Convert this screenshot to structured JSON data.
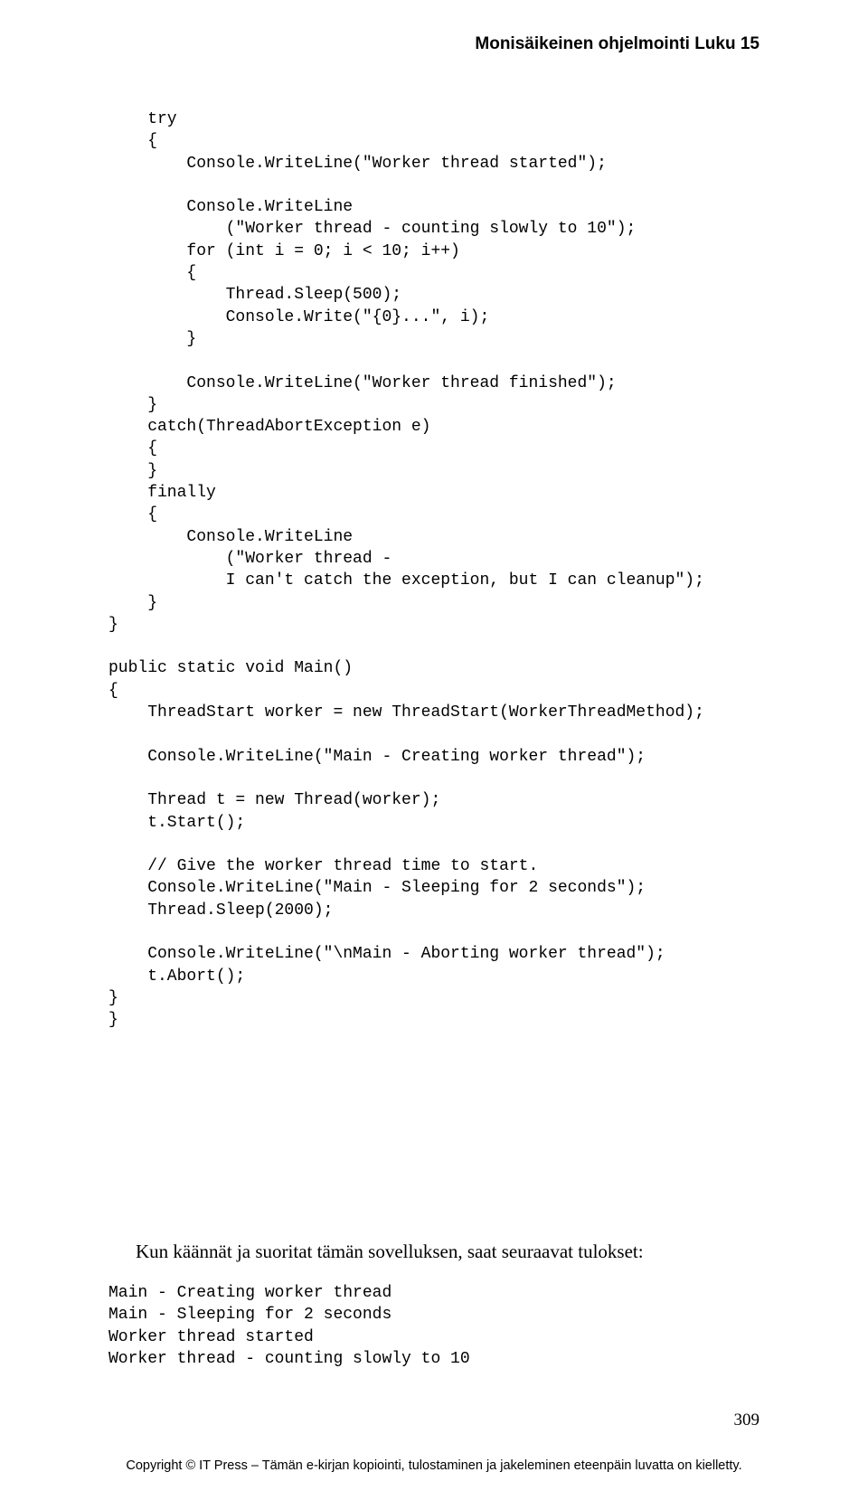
{
  "header": "Monisäikeinen ohjelmointi  Luku 15",
  "code": "    try\n    {\n        Console.WriteLine(\"Worker thread started\");\n\n        Console.WriteLine\n            (\"Worker thread - counting slowly to 10\");\n        for (int i = 0; i < 10; i++)\n        {\n            Thread.Sleep(500);\n            Console.Write(\"{0}...\", i);\n        }\n\n        Console.WriteLine(\"Worker thread finished\");\n    }\n    catch(ThreadAbortException e)\n    {\n    }\n    finally\n    {\n        Console.WriteLine\n            (\"Worker thread -\n            I can't catch the exception, but I can cleanup\");\n    }\n}\n\npublic static void Main()\n{\n    ThreadStart worker = new ThreadStart(WorkerThreadMethod);\n\n    Console.WriteLine(\"Main - Creating worker thread\");\n\n    Thread t = new Thread(worker);\n    t.Start();\n\n    // Give the worker thread time to start.\n    Console.WriteLine(\"Main - Sleeping for 2 seconds\");\n    Thread.Sleep(2000);\n\n    Console.WriteLine(\"\\nMain - Aborting worker thread\");\n    t.Abort();\n}\n}",
  "body_text": "Kun käännät ja suoritat tämän sovelluksen, saat seuraavat tulokset:",
  "output": "Main - Creating worker thread\nMain - Sleeping for 2 seconds\nWorker thread started\nWorker thread - counting slowly to 10",
  "page_number": "309",
  "footer": "Copyright © IT Press – Tämän e-kirjan kopiointi, tulostaminen ja jakeleminen eteenpäin luvatta on kielletty."
}
